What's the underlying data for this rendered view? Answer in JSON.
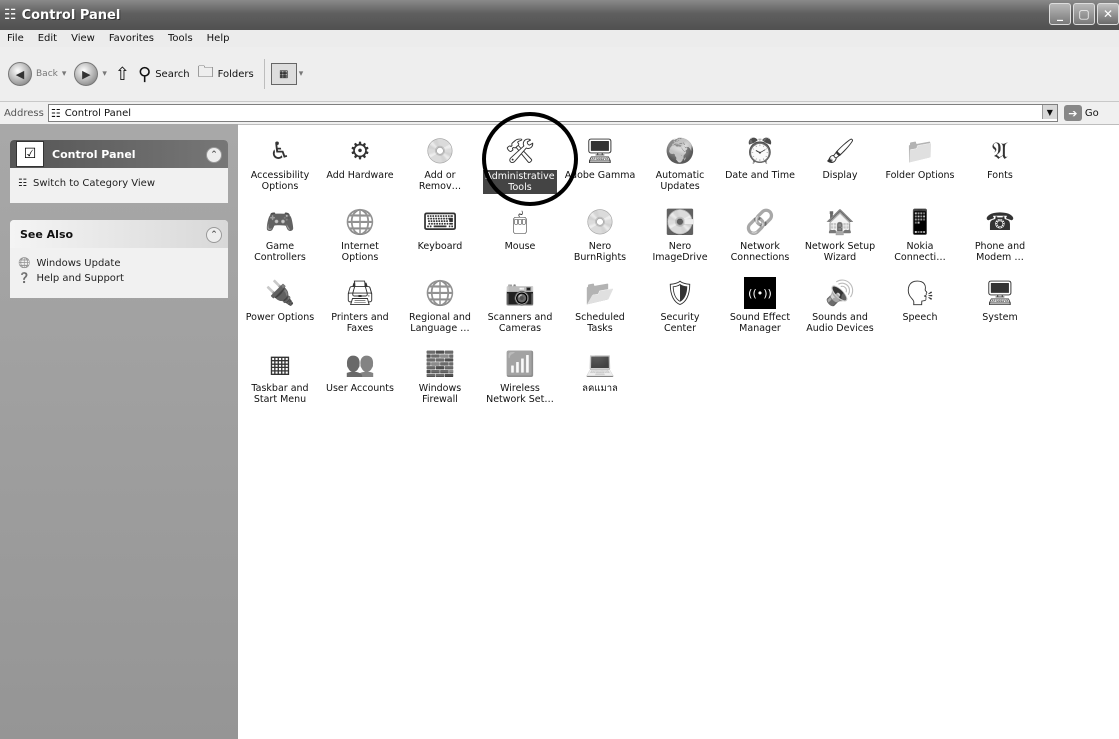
{
  "window": {
    "title": "Control Panel",
    "title_icon": "control-panel-icon"
  },
  "window_buttons": {
    "minimize": "_",
    "maximize": "▢",
    "close": "✕"
  },
  "menu": [
    "File",
    "Edit",
    "View",
    "Favorites",
    "Tools",
    "Help"
  ],
  "toolbar": {
    "back": "Back",
    "search": "Search",
    "folders": "Folders"
  },
  "address": {
    "label": "Address",
    "value": "Control Panel",
    "go": "Go"
  },
  "leftpane": {
    "control_panel": {
      "title": "Control Panel",
      "switch_link": "Switch to Category View"
    },
    "see_also": {
      "title": "See Also",
      "links": [
        "Windows Update",
        "Help and Support"
      ]
    }
  },
  "items": [
    {
      "label": "Accessibility\nOptions",
      "icon": "♿"
    },
    {
      "label": "Add Hardware",
      "icon": "⚙"
    },
    {
      "label": "Add or\nRemov…",
      "icon": "💿"
    },
    {
      "label": "Administrative\nTools",
      "icon": "🛠"
    },
    {
      "label": "Adobe Gamma",
      "icon": "🖥"
    },
    {
      "label": "Automatic\nUpdates",
      "icon": "🌍"
    },
    {
      "label": "Date and Time",
      "icon": "⏰"
    },
    {
      "label": "Display",
      "icon": "🖌"
    },
    {
      "label": "Folder Options",
      "icon": "📁"
    },
    {
      "label": "Fonts",
      "icon": "𝔄"
    },
    {
      "label": "Game\nControllers",
      "icon": "🎮"
    },
    {
      "label": "Internet\nOptions",
      "icon": "🌐"
    },
    {
      "label": "Keyboard",
      "icon": "⌨"
    },
    {
      "label": "Mouse",
      "icon": "🖱"
    },
    {
      "label": "Nero\nBurnRights",
      "icon": "💿"
    },
    {
      "label": "Nero\nImageDrive",
      "icon": "💽"
    },
    {
      "label": "Network\nConnections",
      "icon": "🔗"
    },
    {
      "label": "Network Setup\nWizard",
      "icon": "🏠"
    },
    {
      "label": "Nokia\nConnecti…",
      "icon": "📱"
    },
    {
      "label": "Phone and\nModem …",
      "icon": "☎"
    },
    {
      "label": "Power Options",
      "icon": "🔌"
    },
    {
      "label": "Printers and\nFaxes",
      "icon": "🖨"
    },
    {
      "label": "Regional and\nLanguage …",
      "icon": "🌐"
    },
    {
      "label": "Scanners and\nCameras",
      "icon": "📷"
    },
    {
      "label": "Scheduled\nTasks",
      "icon": "📂"
    },
    {
      "label": "Security\nCenter",
      "icon": "🛡"
    },
    {
      "label": "Sound Effect\nManager",
      "icon": "((•))"
    },
    {
      "label": "Sounds and\nAudio Devices",
      "icon": "🔊"
    },
    {
      "label": "Speech",
      "icon": "🗣"
    },
    {
      "label": "System",
      "icon": "🖥"
    },
    {
      "label": "Taskbar and\nStart Menu",
      "icon": "▦"
    },
    {
      "label": "User Accounts",
      "icon": "👥"
    },
    {
      "label": "Windows\nFirewall",
      "icon": "🧱"
    },
    {
      "label": "Wireless\nNetwork Set…",
      "icon": "📶"
    },
    {
      "label": "ลคแมาล",
      "icon": "💻"
    }
  ]
}
